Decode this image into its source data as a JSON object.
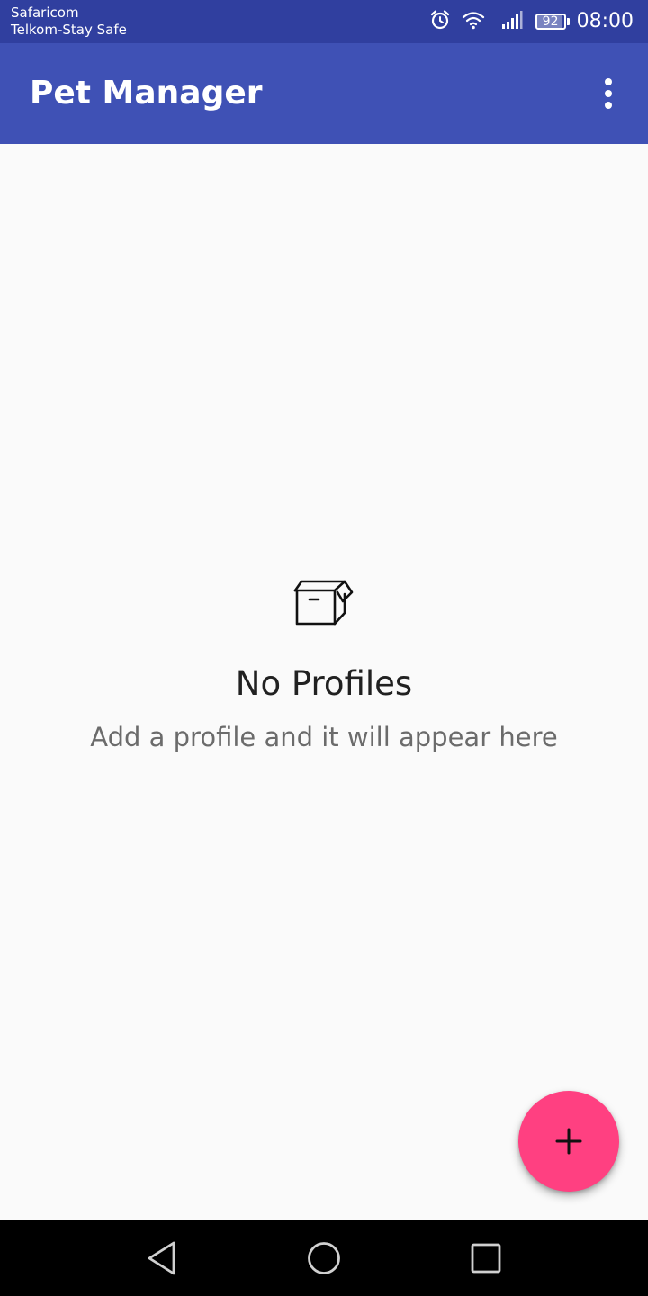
{
  "status_bar": {
    "carrier_primary": "Safaricom",
    "carrier_secondary": "Telkom-Stay Safe",
    "battery_level": "92",
    "time": "08:00",
    "icons": [
      "alarm-icon",
      "wifi-icon",
      "signal-icon",
      "battery-icon"
    ]
  },
  "app_bar": {
    "title": "Pet Manager",
    "menu_icon": "more-vert-icon"
  },
  "empty_state": {
    "icon": "empty-box-icon",
    "title": "No Profiles",
    "subtitle": "Add a profile and it will appear here"
  },
  "fab": {
    "icon": "add-icon"
  },
  "nav_bar": {
    "icons": [
      "back-icon",
      "home-icon",
      "recents-icon"
    ]
  },
  "colors": {
    "status_bar": "#303f9f",
    "app_bar": "#3f51b5",
    "background": "#fafafa",
    "fab": "#ff4081",
    "nav_bar": "#000000"
  }
}
